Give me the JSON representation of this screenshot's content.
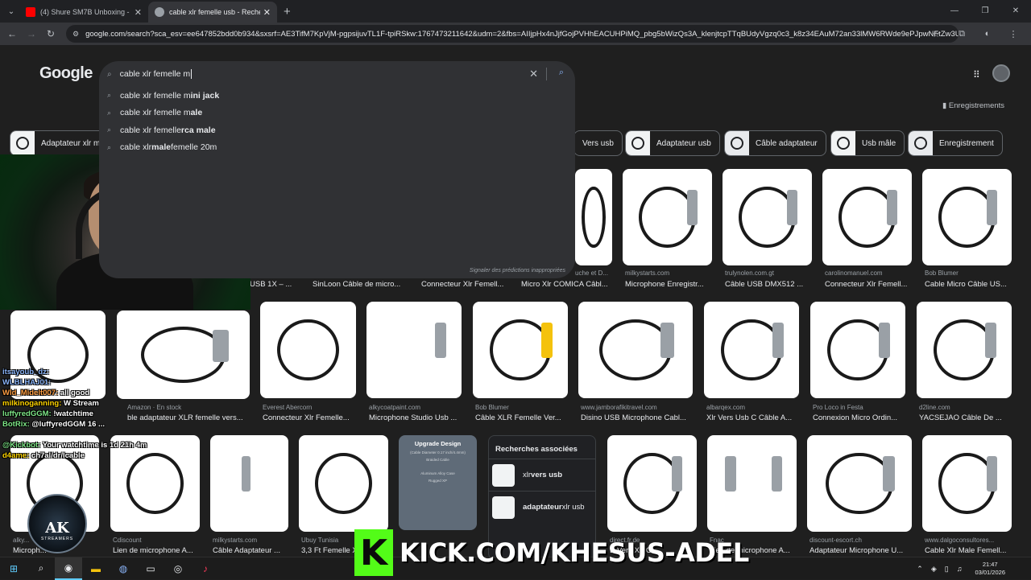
{
  "browser": {
    "tabs": [
      {
        "title": "(4) Shure SM7B Unboxing - You",
        "favicon_color": "#ff0000",
        "active": false
      },
      {
        "title": "cable xlr femelle usb - Recherch",
        "favicon_color": "#9aa0a6",
        "active": true
      }
    ],
    "url": "google.com/search?sca_esv=ee647852bdd0b934&sxsrf=AE3TifM7KpVjM-pgpsijuvTL1F-tpiRSkw:1767473211642&udm=2&fbs=AIIjpHx4nJjfGojPVHhEACUHPiMQ_pbg5bWizQs3A_klenjtcpTTqBUdyVgzq0c3_k8z34EAuM72an33lMW6RWde9ePJpwNFtZw3UQ..."
  },
  "google": {
    "logo": "Google",
    "query": "cable xlr femelle m",
    "suggestions": [
      {
        "plain": "cable xlr femelle m",
        "bold": "ini jack",
        "tail": ""
      },
      {
        "plain": "cable xlr femelle m",
        "bold": "ale",
        "tail": ""
      },
      {
        "plain": "cable xlr femelle ",
        "bold": "rca male",
        "tail": ""
      },
      {
        "plain": "cable xlr ",
        "bold": "male",
        "tail": " femelle 20m"
      }
    ],
    "report": "Signaler des prédictions inappropriées",
    "saved": "Enregistrements",
    "chips": [
      "Adaptateur xlr m",
      "Vers usb",
      "Adaptateur usb",
      "Câble adaptateur",
      "Usb mâle",
      "Enregistrement"
    ],
    "row1_partial": [
      {
        "source": "",
        "caption": "USB 1X – ..."
      },
      {
        "source": "",
        "caption": "SinLoon Câble de micro..."
      },
      {
        "source": "",
        "caption": "Connecteur Xlr Femell..."
      },
      {
        "source": "uche et D...",
        "caption": "Micro Xlr COMICA Câbl..."
      }
    ],
    "row1": [
      {
        "source": "milkystarts.com",
        "caption": "Microphone Enregistr..."
      },
      {
        "source": "trulynolen.com.gt",
        "caption": "Câble USB DMX512 ..."
      },
      {
        "source": "carolinomanuel.com",
        "caption": "Connecteur Xlr Femell..."
      },
      {
        "source": "Bob Blumer",
        "caption": "Cable Micro Câble US..."
      }
    ],
    "row2": [
      {
        "source": "Amazon · En stock",
        "caption": "ble adaptateur XLR femelle vers..."
      },
      {
        "source": "Everest Abercorn",
        "caption": "Connecteur Xlr Femelle..."
      },
      {
        "source": "alkycoatpaint.com",
        "caption": "Microphone Studio Usb ..."
      },
      {
        "source": "Bob Blumer",
        "caption": "Câble XLR Femelle Ver..."
      },
      {
        "source": "www.jamborafikitravel.com",
        "caption": "Disino USB Microphone Cabl..."
      },
      {
        "source": "albarqex.com",
        "caption": "Xlr Vers Usb C Câble A..."
      },
      {
        "source": "Pro Loco in Festa",
        "caption": "Connexion Micro Ordin..."
      },
      {
        "source": "d2line.com",
        "caption": "YACSEJAO Câble De ..."
      }
    ],
    "row3": [
      {
        "source": "alky...",
        "caption": "Microph..."
      },
      {
        "source": "Cdiscount",
        "caption": "Lien de microphone A..."
      },
      {
        "source": "milkystarts.com",
        "caption": "Câble Adaptateur ..."
      },
      {
        "source": "Ubuy Tunisia",
        "caption": "3,3 Ft Femelle X..."
      },
      {
        "source": "direct.fr.de",
        "caption": "B Vers Xlr C..."
      },
      {
        "source": "Fnac",
        "caption": "Lien de microphone A..."
      },
      {
        "source": "discount-escort.ch",
        "caption": "Adaptateur Microphone U..."
      },
      {
        "source": "www.dalgoconsultores...",
        "caption": "Cable Xlr Male Femell..."
      }
    ],
    "upgrade": {
      "title": "Upgrade Design",
      "sub": "(Cable Diameter 0.17 inch/4.4mm)",
      "sub2": "Braided Cable",
      "sub3": "Aluminum Alloy Case",
      "sub4": "Rugged XP"
    },
    "related": {
      "title": "Recherches associées",
      "items": [
        {
          "plain": "xlr ",
          "bold": "vers usb"
        },
        {
          "plain": "",
          "bold": "adaptateur",
          "tail": " xlr usb"
        }
      ]
    }
  },
  "overlay": {
    "chat": [
      {
        "user": "itsayoub_dz:",
        "msg": "",
        "ucolor": "#8ab4f8"
      },
      {
        "user": "WLBLHAJ01:",
        "msg": "",
        "ucolor": "#8ab4f8"
      },
      {
        "user": "Wld_Midelt007:",
        "msg": " all good",
        "ucolor": "#ff9f43"
      },
      {
        "user": "milkinoganning:",
        "msg": " W Stream",
        "ucolor": "#ffd400"
      },
      {
        "user": "luffyredGGM:",
        "msg": " !watchtime",
        "ucolor": "#7ee787"
      },
      {
        "user": "BotRix:",
        "msg": " @luffyredGGM 16 ...",
        "ucolor": "#7ee787"
      },
      {
        "user": "",
        "msg": "",
        "ucolor": "#ffffff"
      },
      {
        "user": "@Kickbot:",
        "msg": " Your watchtime is 1d 21h 4m",
        "ucolor": "#7ee787"
      },
      {
        "user": "d4ame:",
        "msg": " ch7al/dr/Icable",
        "ucolor": "#ffd400"
      }
    ],
    "logo_main": "AK",
    "logo_sub": "STREAMERS",
    "kick": "KICK.COM/KHESUS-ADEL"
  },
  "taskbar": {
    "time": "21:47",
    "date": "03/01/2026"
  }
}
